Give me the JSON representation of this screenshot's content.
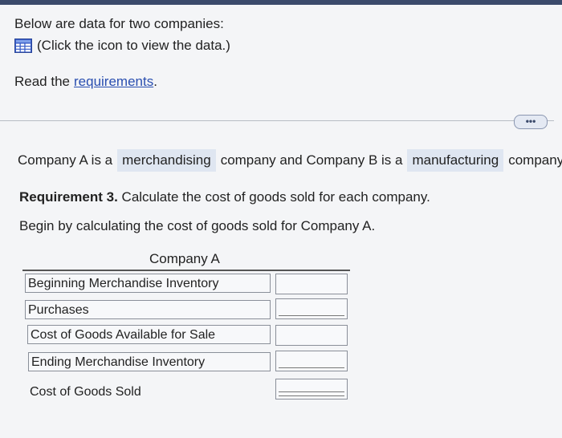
{
  "intro": {
    "text": "Below are data for two companies:"
  },
  "data_link": {
    "text": "(Click the icon to view the data.)"
  },
  "requirements": {
    "prefix": "Read the",
    "link": "requirements",
    "suffix": "."
  },
  "more_button": "•••",
  "statement": {
    "part1": "Company A is a",
    "hl1": "merchandising",
    "part2": "company and Company B is a",
    "hl2": "manufacturing",
    "part3": "company."
  },
  "requirement3": {
    "bold": "Requirement 3.",
    "text": " Calculate the cost of goods sold for each company."
  },
  "begin": "Begin by calculating the cost of goods sold for Company A.",
  "table": {
    "title": "Company A",
    "rows": [
      {
        "label": "Beginning Merchandise Inventory",
        "value": ""
      },
      {
        "label": "Purchases",
        "value": ""
      },
      {
        "label": "Cost of Goods Available for Sale",
        "value": ""
      },
      {
        "label": "Ending Merchandise Inventory",
        "value": ""
      },
      {
        "label": "Cost of Goods Sold",
        "value": ""
      }
    ]
  },
  "colors": {
    "link": "#2a4fb0",
    "highlight": "#dfe6f1",
    "icon": "#3a5fc8"
  },
  "icons": {
    "data": "table-grid-icon"
  }
}
